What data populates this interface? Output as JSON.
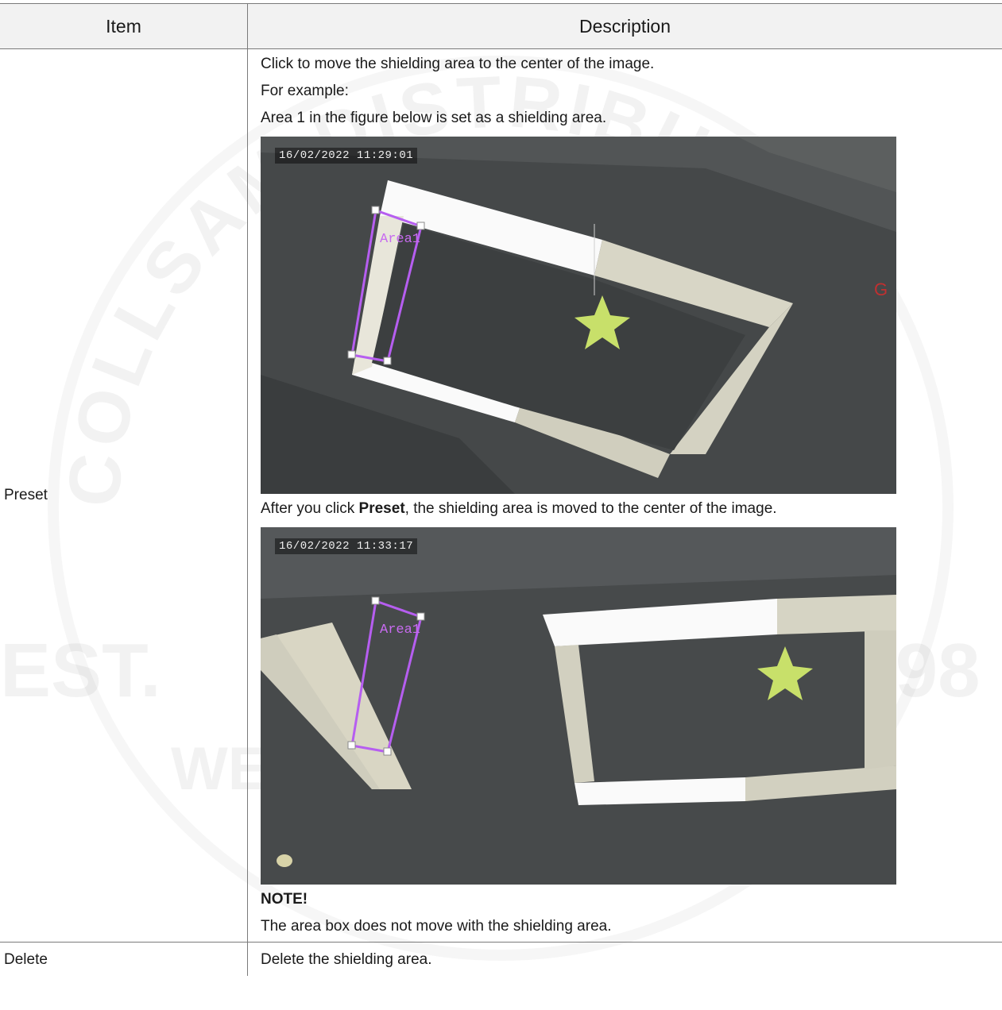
{
  "table": {
    "header": {
      "item": "Item",
      "description": "Description"
    },
    "rows": [
      {
        "item": "Preset",
        "description": {
          "line1": "Click to move the shielding area to the center of the image.",
          "line2": "For example:",
          "line3": "Area 1 in the figure below is set as a shielding area.",
          "figure1": {
            "timestamp": "16/02/2022 11:29:01",
            "area_label": "Area1"
          },
          "after_prefix": "After you click ",
          "after_bold": "Preset",
          "after_suffix": ", the shielding area is moved to the center of the image.",
          "figure2": {
            "timestamp": "16/02/2022 11:33:17",
            "area_label": "Area1"
          },
          "note_title": "NOTE!",
          "note_text": "The area box does not move with the shielding area."
        }
      },
      {
        "item": "Delete",
        "description_text": "Delete the shielding area."
      }
    ]
  },
  "watermark": {
    "arc_text": "COLLSAM DISTRIBUTION",
    "left_text": "EST.",
    "right_text": "1998",
    "slogan": "WE SECURE YOUR LIFE"
  },
  "colors": {
    "header_bg": "#f2f2f2",
    "border": "#7a7a7a",
    "area_box": "#b65ef0",
    "camera_bg": "#46494a"
  }
}
